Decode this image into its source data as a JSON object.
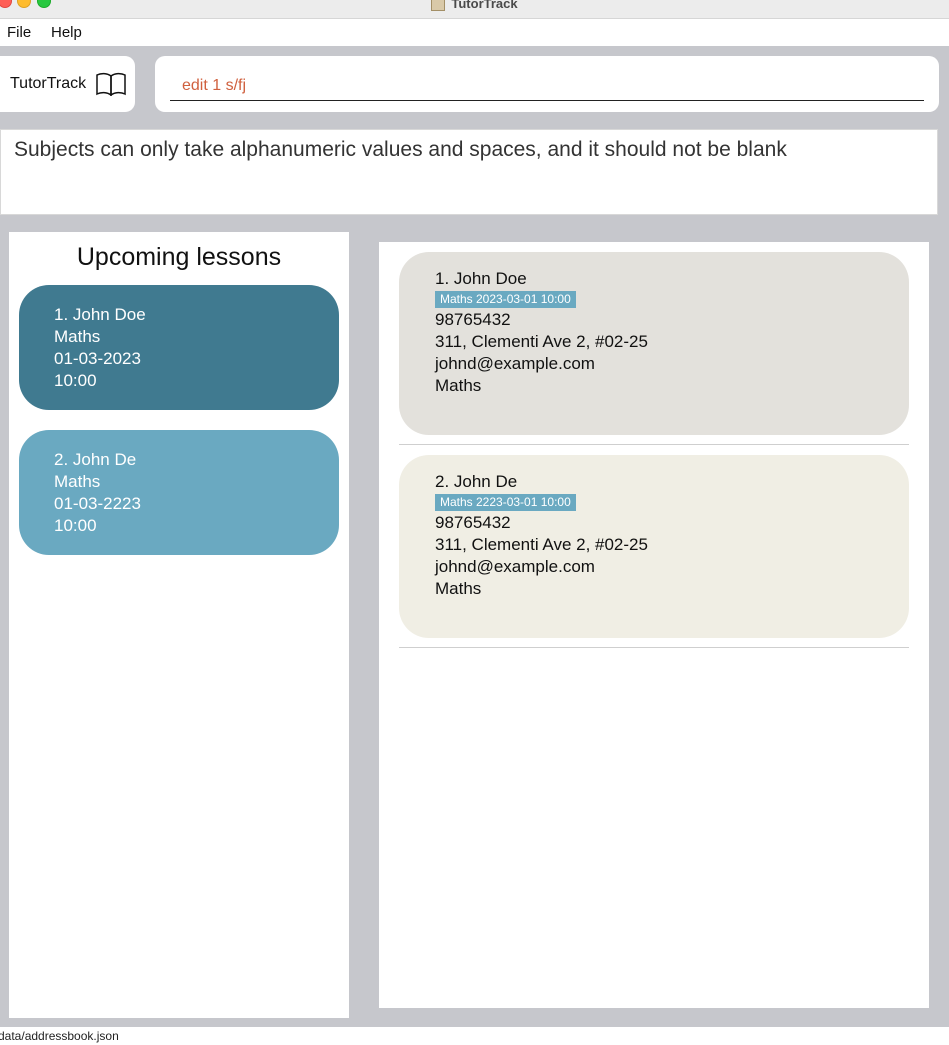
{
  "window": {
    "title": "TutorTrack"
  },
  "menu": {
    "file": "File",
    "help": "Help"
  },
  "brand": {
    "name": "TutorTrack",
    "icon": "book-icon"
  },
  "command": {
    "value": "edit 1 s/fj"
  },
  "result": {
    "message": "Subjects can only take alphanumeric values and spaces, and it should not be blank"
  },
  "upcoming": {
    "title": "Upcoming lessons",
    "lessons": [
      {
        "name": "1.  John Doe",
        "subject": "Maths",
        "date": "01-03-2023",
        "time": "10:00"
      },
      {
        "name": "2.  John De",
        "subject": "Maths",
        "date": "01-03-2223",
        "time": "10:00"
      }
    ]
  },
  "persons": [
    {
      "name": "1.  John Doe",
      "tag": "Maths 2023-03-01 10:00",
      "phone": "98765432",
      "address": "311, Clementi Ave 2, #02-25",
      "email": "johnd@example.com",
      "subject": "Maths"
    },
    {
      "name": "2.  John De",
      "tag": "Maths 2223-03-01 10:00",
      "phone": "98765432",
      "address": "311, Clementi Ave 2, #02-25",
      "email": "johnd@example.com",
      "subject": "Maths"
    }
  ],
  "status": {
    "path": "data/addressbook.json"
  },
  "colors": {
    "lesson_dark": "#407a90",
    "lesson_light": "#6aa9c1",
    "command_text": "#d0603e"
  }
}
